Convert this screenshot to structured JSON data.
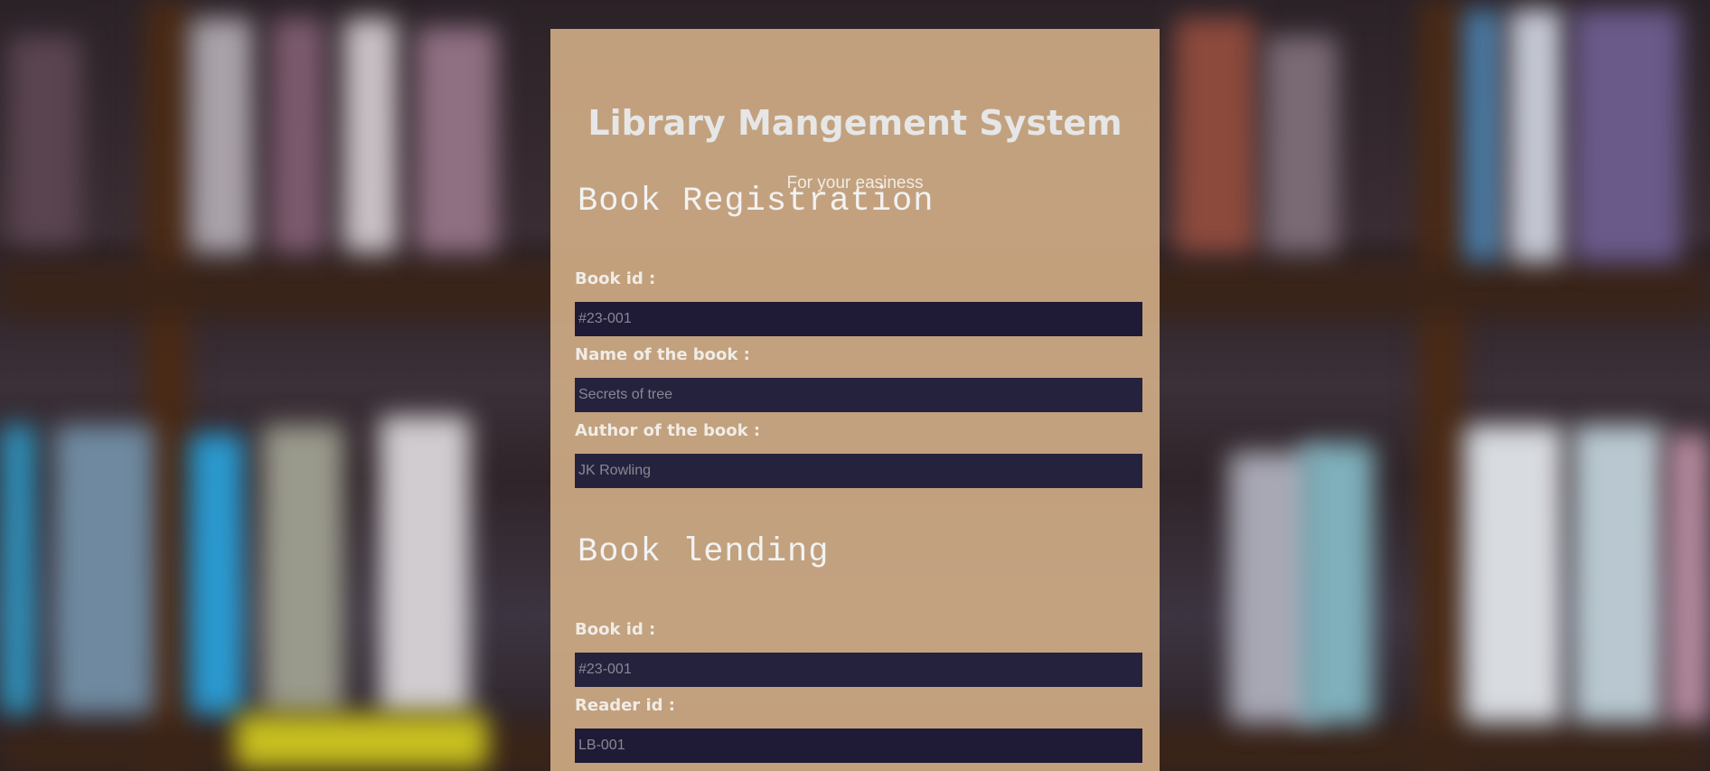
{
  "header": {
    "title": "Library Mangement System",
    "subtitle": "For your easiness"
  },
  "registration": {
    "heading": "Book Registration",
    "book_id_label": "Book id :",
    "book_id_placeholder": "#23-001",
    "book_name_label": "Name of the book :",
    "book_name_placeholder": "Secrets of tree",
    "author_label": "Author of the book :",
    "author_placeholder": "JK Rowling"
  },
  "lending": {
    "heading": "Book lending",
    "book_id_label": "Book id :",
    "book_id_placeholder": "#23-001",
    "reader_id_label": "Reader id :",
    "reader_id_placeholder": "LB-001"
  },
  "colors": {
    "panel": "#d6b28a",
    "input_background": "#1f1a35",
    "text_light": "#f0ece6"
  }
}
